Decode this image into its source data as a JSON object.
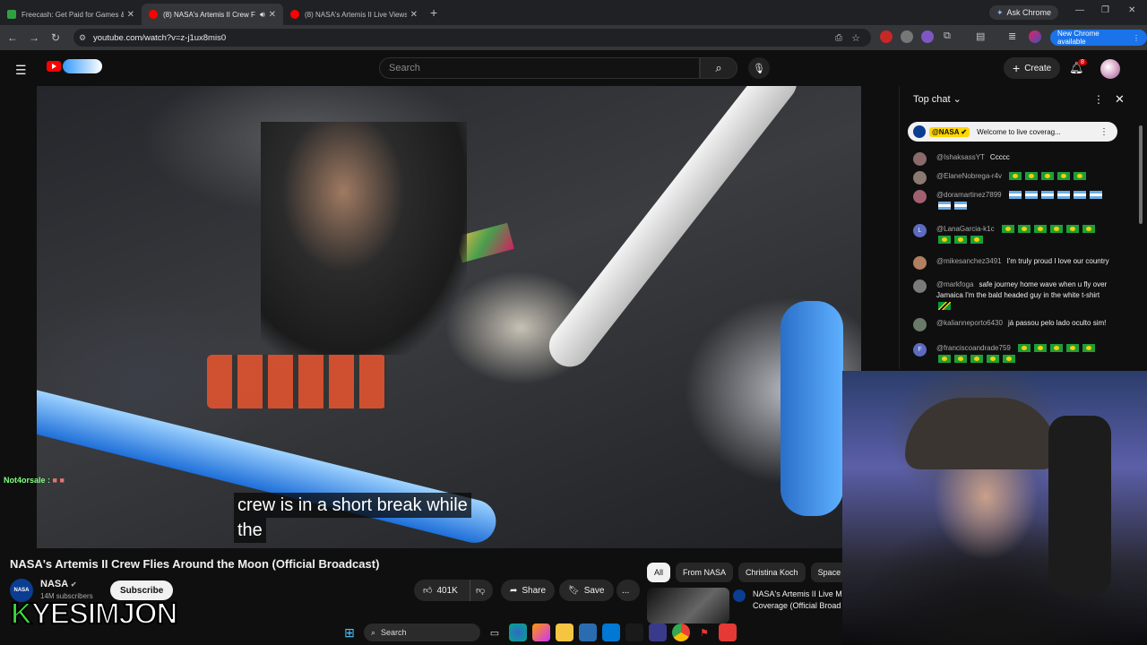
{
  "browser": {
    "tabs": [
      {
        "title": "Freecash: Get Paid for Games &",
        "favicon_color": "#2ea043",
        "active": false
      },
      {
        "title": "(8) NASA's Artemis II Crew F",
        "favicon_color": "#ff0000",
        "active": true
      },
      {
        "title": "(8) NASA's Artemis II Live Views",
        "favicon_color": "#ff0000",
        "active": false
      }
    ],
    "new_tab_icon": "plus-icon",
    "ask_chrome": "Ask Chrome",
    "url": "youtube.com/watch?v=z-j1ux8mis0",
    "new_chrome": "New Chrome available"
  },
  "youtube": {
    "search_placeholder": "Search",
    "create_label": "Create",
    "notification_count": "8"
  },
  "video": {
    "subtitle_line1": "crew is in a short break while",
    "subtitle_line2": "the",
    "stream_tag": "Not4orsale :",
    "title": "NASA's Artemis II Crew Flies Around the Moon (Official Broadcast)",
    "channel": "NASA",
    "channel_avatar_text": "NASA",
    "subscribers": "14M subscribers",
    "subscribe": "Subscribe",
    "likes": "401K",
    "share": "Share",
    "save": "Save",
    "more": "..."
  },
  "chips": [
    "All",
    "From NASA",
    "Christina Koch",
    "Space"
  ],
  "recommended": {
    "title_line1": "NASA's Artemis II Live M",
    "title_line2": "Coverage (Official Broad"
  },
  "chat": {
    "header": "Top chat",
    "pinned_author": "@NASA",
    "pinned_text": "Welcome to live coverag...",
    "messages": [
      {
        "author": "@IshaksassYT",
        "text": "Ccccc",
        "flags": [],
        "avatar": "#8a6b6b"
      },
      {
        "author": "@ElaneNobrega-r4v",
        "text": "",
        "flags": [
          "br",
          "br",
          "br",
          "br",
          "br"
        ],
        "avatar": "#8b7a70"
      },
      {
        "author": "@doramartinez7899",
        "text": "",
        "flags": [
          "ar",
          "ar",
          "ar",
          "ar",
          "ar",
          "ar",
          "ar",
          "ar"
        ],
        "avatar": "#a06070"
      },
      {
        "author": "@LanaGarcia-k1c",
        "text": "",
        "flags": [
          "br",
          "br",
          "br",
          "br",
          "br",
          "br",
          "br",
          "br",
          "br"
        ],
        "avatar": "#5c6bc0"
      },
      {
        "author": "@mikesanchez3491",
        "text": "I'm truly proud I love our country",
        "flags": [],
        "avatar": "#b08060"
      },
      {
        "author": "@markfoga",
        "text": "safe journey home wave when u fly over Jamaica I'm the bald headed guy in the white t-shirt",
        "flags": [
          "jm"
        ],
        "avatar": "#7a7a7a"
      },
      {
        "author": "@kalianneporto6430",
        "text": "já passou pelo lado oculto sim!",
        "flags": [],
        "avatar": "#6a7a6a"
      },
      {
        "author": "@franciscoandrade759",
        "text": "",
        "flags": [
          "br",
          "br",
          "br",
          "br",
          "br",
          "br",
          "br",
          "br",
          "br",
          "br"
        ],
        "avatar": "#5c6bc0"
      }
    ]
  },
  "overlay": {
    "logo_k": "K",
    "logo_rest": "YESIMJON"
  },
  "taskbar": {
    "search_label": "Search"
  }
}
